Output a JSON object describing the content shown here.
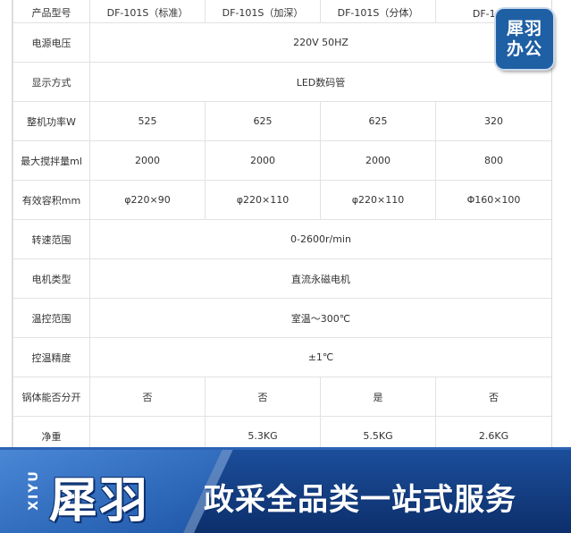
{
  "table": {
    "header": {
      "label": "产品型号",
      "models": [
        "DF-101S（标准）",
        "DF-101S（加深）",
        "DF-101S（分体）",
        "DF-101Z"
      ]
    },
    "rows": [
      {
        "label": "电源电压",
        "merged": "220V 50HZ"
      },
      {
        "label": "显示方式",
        "merged": "LED数码管"
      },
      {
        "label": "整机功率W",
        "values": [
          "525",
          "625",
          "625",
          "320"
        ]
      },
      {
        "label": "最大搅拌量ml",
        "values": [
          "2000",
          "2000",
          "2000",
          "800"
        ]
      },
      {
        "label": "有效容积mm",
        "values": [
          "φ220×90",
          "φ220×110",
          "φ220×110",
          "Φ160×100"
        ]
      },
      {
        "label": "转速范围",
        "merged": "0-2600r/min"
      },
      {
        "label": "电机类型",
        "merged": "直流永磁电机"
      },
      {
        "label": "温控范围",
        "merged": "室温～300℃"
      },
      {
        "label": "控温精度",
        "merged": "±1℃"
      },
      {
        "label": "锅体能否分开",
        "values": [
          "否",
          "否",
          "是",
          "否"
        ]
      },
      {
        "label": "净重",
        "values": [
          "",
          "5.3KG",
          "5.5KG",
          "2.6KG"
        ]
      }
    ]
  },
  "badge": {
    "line1": "犀羽",
    "line2": "办公"
  },
  "banner": {
    "brand": "犀羽",
    "pinyin": "XIYU",
    "slogan": "政采全品类一站式服务",
    "colors": {
      "dark": "#0d2f6b",
      "mid": "#1c4f9c",
      "light": "#3f7fd0"
    }
  }
}
